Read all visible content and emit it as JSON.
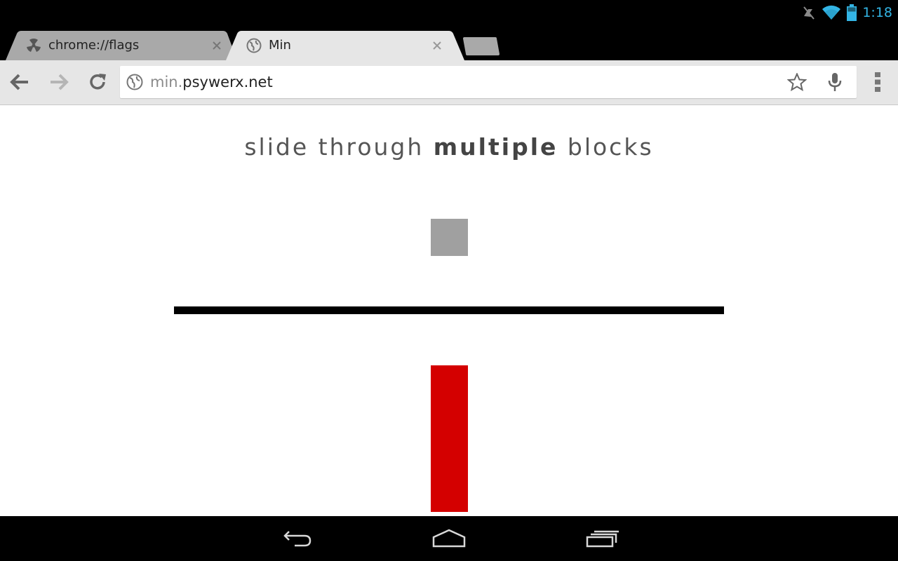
{
  "status_bar": {
    "time": "1:18",
    "icons": [
      "mute-icon",
      "wifi-icon",
      "battery-icon"
    ],
    "accent_color": "#33b5e5"
  },
  "tabs": [
    {
      "title": "chrome://flags",
      "favicon": "radiation-icon",
      "active": false
    },
    {
      "title": "Min",
      "favicon": "globe-icon",
      "active": true
    }
  ],
  "toolbar": {
    "url_muted": "min.",
    "url_main": "psywerx.net"
  },
  "page": {
    "headline_before": "slide through ",
    "headline_bold": "multiple",
    "headline_after": " blocks",
    "grey_block_color": "#a0a0a0",
    "bar_color": "#000000",
    "red_block_color": "#d40000"
  }
}
